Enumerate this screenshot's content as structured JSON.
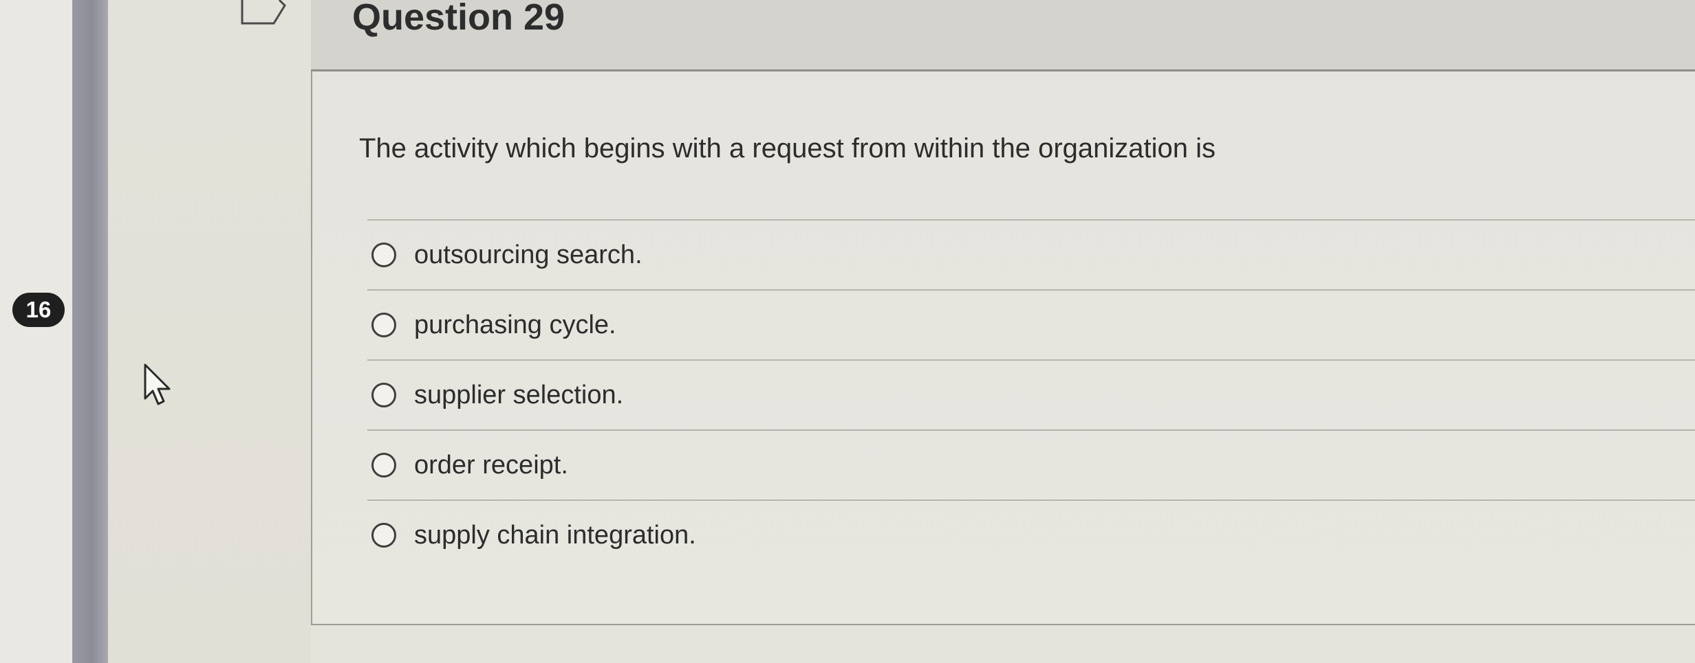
{
  "quiz": {
    "page_badge": "16",
    "question_title": "Question 29",
    "question_text": "The activity which begins with a request from within the organization is",
    "answers": [
      {
        "label": "outsourcing search."
      },
      {
        "label": "purchasing cycle."
      },
      {
        "label": "supplier selection."
      },
      {
        "label": "order receipt."
      },
      {
        "label": "supply chain integration."
      }
    ]
  },
  "icons": {
    "flag": "flag-outline-icon",
    "cursor": "mouse-pointer-icon",
    "radio": "radio-unselected-icon"
  },
  "colors": {
    "header_background": "#d4d3cd",
    "card_background": "#e5e4de",
    "rail_stripe": "#8c8c97",
    "badge_background": "#1f1f1f"
  }
}
